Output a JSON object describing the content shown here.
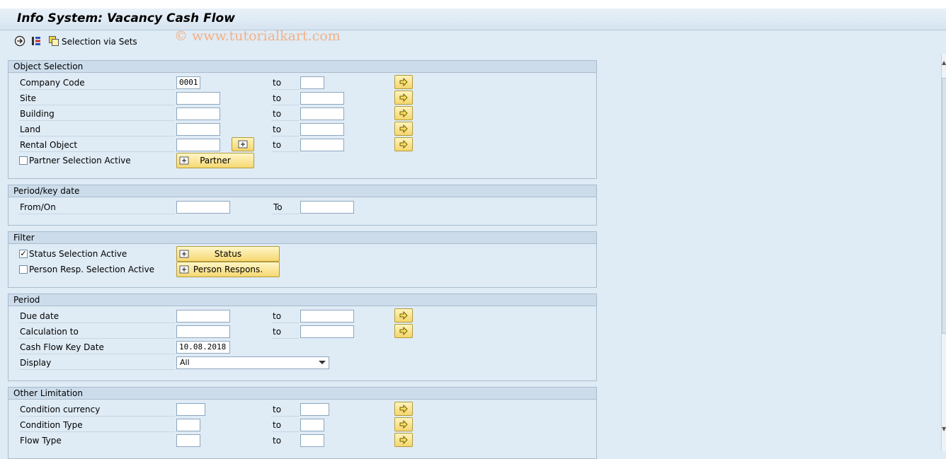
{
  "watermark": "© www.tutorialkart.com",
  "title": "Info System: Vacancy Cash Flow",
  "toolbar": {
    "icons": [
      "execute-icon",
      "multiple-selection-icon",
      "selection-via-sets-icon"
    ],
    "sets_label": "Selection via Sets"
  },
  "object_selection": {
    "header": "Object Selection",
    "company_code": {
      "label": "Company Code",
      "value": "0001",
      "to": "to"
    },
    "site": {
      "label": "Site",
      "to": "to"
    },
    "building": {
      "label": "Building",
      "to": "to"
    },
    "land": {
      "label": "Land",
      "to": "to"
    },
    "rental_object": {
      "label": "Rental Object",
      "to": "to"
    },
    "partner_active": {
      "label": "Partner Selection Active",
      "checked": false
    },
    "partner_button": "Partner"
  },
  "period_key": {
    "header": "Period/key date",
    "from_label": "From/On",
    "to_label": "To"
  },
  "filter": {
    "header": "Filter",
    "status_active": {
      "label": "Status Selection Active",
      "checked": true,
      "mark": "✓"
    },
    "status_button": "Status",
    "person_active": {
      "label": "Person Resp. Selection Active",
      "checked": false
    },
    "person_button": "Person Respons."
  },
  "period": {
    "header": "Period",
    "due_date": {
      "label": "Due date",
      "to": "to"
    },
    "calc_to": {
      "label": "Calculation to",
      "to": "to"
    },
    "cf_key_date": {
      "label": "Cash Flow Key Date",
      "value": "10.08.2018"
    },
    "display": {
      "label": "Display",
      "value": "All"
    }
  },
  "other": {
    "header": "Other Limitation",
    "cond_currency": {
      "label": "Condition currency",
      "to": "to"
    },
    "cond_type": {
      "label": "Condition Type",
      "to": "to"
    },
    "flow_type": {
      "label": "Flow Type",
      "to": "to"
    }
  },
  "colors": {
    "accent_yellow": "#f5d66b",
    "background": "#dfebf5",
    "group_header": "#ccdceb"
  }
}
